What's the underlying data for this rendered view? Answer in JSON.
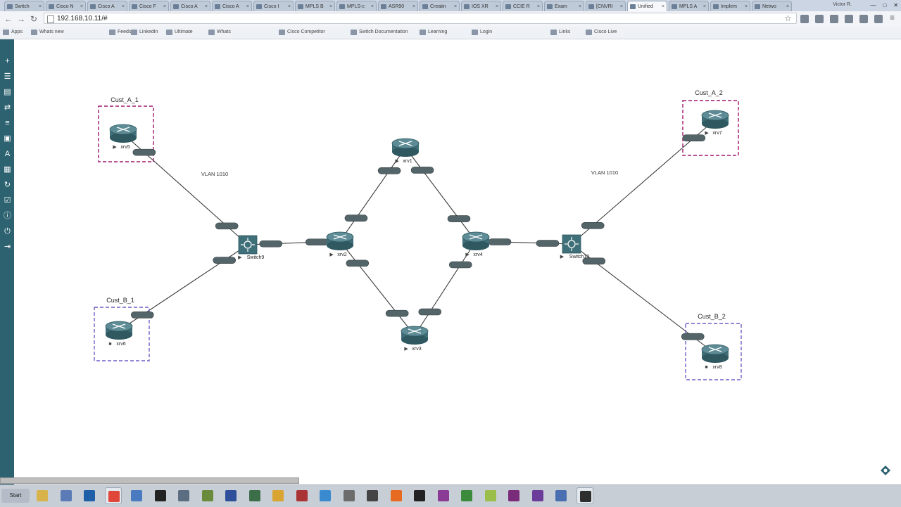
{
  "browser": {
    "tabs": [
      {
        "label": "Switch"
      },
      {
        "label": "Cisco N"
      },
      {
        "label": "Cisco A"
      },
      {
        "label": "Cisco F"
      },
      {
        "label": "Cisco A"
      },
      {
        "label": "Cisco A"
      },
      {
        "label": "Cisco I"
      },
      {
        "label": "MPLS B"
      },
      {
        "label": "MPLS-c"
      },
      {
        "label": "ASR90"
      },
      {
        "label": "Creatin"
      },
      {
        "label": "IOS XR"
      },
      {
        "label": "CCIE R"
      },
      {
        "label": "Exam"
      },
      {
        "label": "[CNVRI"
      },
      {
        "label": "Unified",
        "active": true
      },
      {
        "label": "MPLS A"
      },
      {
        "label": "Implem"
      },
      {
        "label": "Netwo"
      }
    ],
    "user": "Victor R.",
    "url": "192.168.10.11/#",
    "bookmarks": [
      "Apps",
      "Whats new",
      "Feeds",
      "LinkedIn",
      "Ultimate",
      "Whats",
      "Cisco Competitor",
      "Switch Documentation",
      "Learning",
      "Login",
      "Links",
      "Cisco Live"
    ]
  },
  "sidebar": {
    "icons": [
      "add-icon",
      "list-icon",
      "stack-icon",
      "swap-icon",
      "align-icon",
      "image-icon",
      "text-icon",
      "grid-icon",
      "refresh-icon",
      "check-icon",
      "info-icon",
      "power-icon",
      "logout-icon"
    ]
  },
  "topology": {
    "groups": [
      {
        "id": "cust_a_1",
        "label": "Cust_A_1",
        "color": "#a1166d"
      },
      {
        "id": "cust_b_1",
        "label": "Cust_B_1",
        "color": "#6b5fc7"
      },
      {
        "id": "cust_a_2",
        "label": "Cust_A_2",
        "color": "#a1166d"
      },
      {
        "id": "cust_b_2",
        "label": "Cust_B_2",
        "color": "#6b5fc7"
      }
    ],
    "vlan_labels": [
      "VLAN 1010",
      "VLAN 1010"
    ],
    "nodes": [
      {
        "id": "xrv1",
        "label": "xrv1",
        "kind": "router",
        "state": "running"
      },
      {
        "id": "xrv2",
        "label": "xrv2",
        "kind": "router",
        "state": "running"
      },
      {
        "id": "xrv3",
        "label": "xrv3",
        "kind": "router",
        "state": "running"
      },
      {
        "id": "xrv4",
        "label": "xrv4",
        "kind": "router",
        "state": "running"
      },
      {
        "id": "xrv5",
        "label": "xrv5",
        "kind": "router",
        "state": "running"
      },
      {
        "id": "xrv6",
        "label": "xrv6",
        "kind": "router",
        "state": "stopped"
      },
      {
        "id": "xrv7",
        "label": "xrv7",
        "kind": "router",
        "state": "running"
      },
      {
        "id": "xrv8",
        "label": "xrv8",
        "kind": "router",
        "state": "stopped"
      },
      {
        "id": "switch9",
        "label": "Switch9",
        "kind": "switch",
        "state": "running"
      },
      {
        "id": "switch10",
        "label": "Switch10",
        "kind": "switch",
        "state": "running"
      }
    ],
    "links": [
      [
        "xrv5",
        "switch9"
      ],
      [
        "xrv6",
        "switch9"
      ],
      [
        "switch9",
        "xrv2"
      ],
      [
        "xrv2",
        "xrv1"
      ],
      [
        "xrv1",
        "xrv4"
      ],
      [
        "xrv2",
        "xrv3"
      ],
      [
        "xrv3",
        "xrv4"
      ],
      [
        "xrv4",
        "switch10"
      ],
      [
        "switch10",
        "xrv7"
      ],
      [
        "switch10",
        "xrv8"
      ]
    ]
  },
  "taskbar": {
    "start_label": "Start",
    "apps": [
      "explorer",
      "apps",
      "photoshop",
      "chrome",
      "remote",
      "terminal",
      "calculator",
      "tools",
      "pen",
      "maps",
      "folder",
      "flag",
      "vpn",
      "settings",
      "monitor",
      "firefox",
      "console",
      "git",
      "vim",
      "notepad",
      "onenote",
      "visio",
      "network",
      "app"
    ],
    "tray": {
      "time": "",
      "date": ""
    }
  },
  "colors": {
    "sidebar": "#2d6270",
    "router": "#3f6f79",
    "interface": "#54656a",
    "link": "#3a3a3a"
  }
}
